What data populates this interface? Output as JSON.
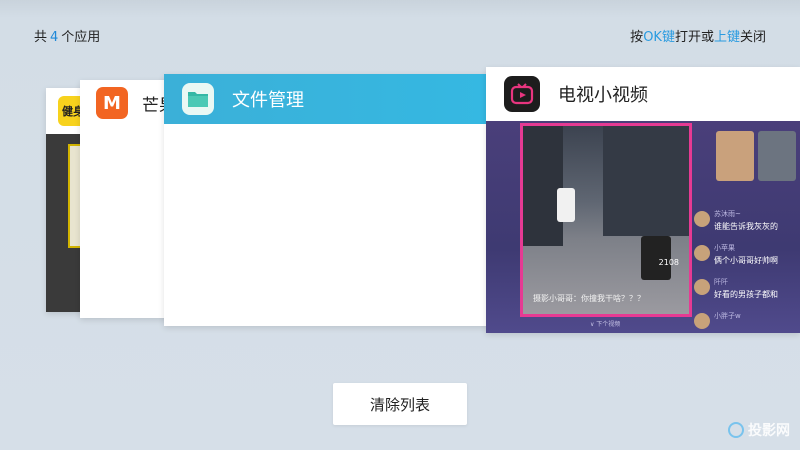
{
  "header": {
    "count_prefix": "共",
    "count": "4",
    "count_suffix": "个应用",
    "hint_press": "按",
    "hint_ok": "OK键",
    "hint_open_or": "打开或",
    "hint_up": "上键",
    "hint_close": "关闭"
  },
  "apps": [
    {
      "icon_label": "健身",
      "icon": "fitness-app-icon"
    },
    {
      "title": "芒果",
      "icon_label": "M",
      "icon": "mango-tv-icon"
    },
    {
      "title": "文件管理",
      "icon": "file-manager-icon"
    },
    {
      "title": "电视小视频",
      "icon": "tv-short-video-icon"
    }
  ],
  "preview": {
    "caption": "摄影小哥哥：你撞我干啥？？？",
    "likes": "2108",
    "down_hint": "∨ 下个视频",
    "comments": [
      {
        "user": "苏沐雨~",
        "text": "谁能告诉我灰灰的"
      },
      {
        "user": "小苹果",
        "text": "俩个小哥哥好帅啊"
      },
      {
        "user": "阡阡",
        "text": "好看的男孩子都和"
      },
      {
        "user": "小胖子w",
        "text": ""
      }
    ]
  },
  "actions": {
    "clear_label": "清除列表"
  },
  "watermark": "投影网",
  "colors": {
    "accent": "#2a9be0",
    "file_header": "#35b8e2",
    "mango": "#f26522",
    "video_border": "#e63a93"
  }
}
